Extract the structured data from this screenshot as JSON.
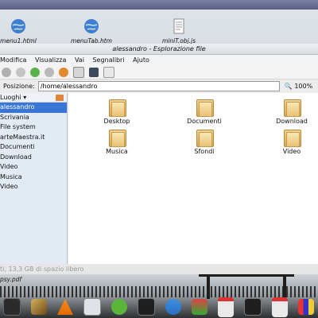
{
  "desktop": {
    "files": [
      {
        "name": "menu1.html",
        "icon": "globe-html-icon"
      },
      {
        "name": "menuTab.htm",
        "icon": "globe-html-icon"
      },
      {
        "name": "miniT.obj.js",
        "icon": "text-file-icon"
      }
    ],
    "wallpaper_label": "psy.pdf"
  },
  "window": {
    "title": "alessandro - Esplorazione file",
    "menu": [
      "Modifica",
      "Visualizza",
      "Vai",
      "Segnalibri",
      "Ajuto"
    ],
    "location_label": "Posizione:",
    "location_value": "/home/alessandro",
    "zoom_value": "100%",
    "sidebar": {
      "header": "Luoghi",
      "items": [
        "alessandro",
        "Scrivania",
        "File system",
        "arteMaestra.it",
        "Documenti",
        "Download",
        "Video",
        "Musica",
        "Video"
      ],
      "selected_index": 0
    },
    "folders": [
      {
        "name": "Desktop"
      },
      {
        "name": "Documenti"
      },
      {
        "name": "Download"
      },
      {
        "name": "Musica"
      },
      {
        "name": "Sfondi"
      },
      {
        "name": "Video"
      }
    ],
    "status": "ti, 13,3 GB di spazio libero"
  },
  "dock": {
    "items": [
      "terminal-icon",
      "quill-icon",
      "vlc-icon",
      "file-manager-icon",
      "media-player-icon",
      "terminal-icon",
      "users-icon",
      "package-icon",
      "window-icon",
      "terminal-icon",
      "window-icon",
      "rubik-icon"
    ]
  },
  "colors": {
    "selection": "#3875d7",
    "sidebar_bg": "#e2ebf4",
    "folder": "#e9c277"
  }
}
